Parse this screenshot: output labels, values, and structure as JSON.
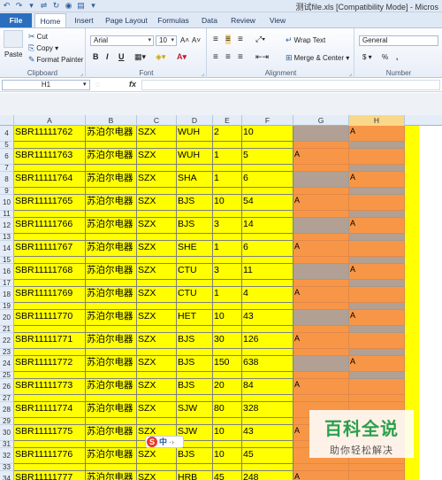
{
  "window": {
    "title": "测试file.xls  [Compatibility Mode] - Micros"
  },
  "qat": [
    "↶",
    "↷",
    "▾",
    "⇌",
    "↻",
    "◉",
    "▤",
    "▾"
  ],
  "tabs": [
    "File",
    "Home",
    "Insert",
    "Page Layout",
    "Formulas",
    "Data",
    "Review",
    "View"
  ],
  "ribbon": {
    "clipboard": {
      "paste": "Paste",
      "cut": "Cut",
      "copy": "Copy ▾",
      "format_painter": "Format Painter",
      "label": "Clipboard"
    },
    "font": {
      "name": "Arial",
      "size": "10",
      "grow": "A˄",
      "shrink": "A˅",
      "bold": "B",
      "italic": "I",
      "underline": "U",
      "label": "Font"
    },
    "alignment": {
      "wrap": "Wrap Text",
      "merge": "Merge & Center ▾",
      "label": "Alignment"
    },
    "number": {
      "format": "General",
      "currency": "$ ▾",
      "percent": "%",
      "comma": ",",
      "label": "Number"
    }
  },
  "formula_bar": {
    "name_box": "H1",
    "fx": "fx"
  },
  "columns": [
    "A",
    "B",
    "C",
    "D",
    "E",
    "F",
    "G",
    "H"
  ],
  "colors": {
    "data_fill": "#ffff00",
    "accent_fill": "#f79646",
    "marked_fill": "#b1a093"
  },
  "rows": [
    {
      "n": "4",
      "a": "SBR11111762",
      "b": "苏泊尔电器",
      "c": "SZX",
      "d": "WUH",
      "e": "2",
      "f": "10",
      "g": "",
      "h": "A",
      "g_dark": true,
      "h_dark": false
    },
    {
      "n": "5",
      "a": "",
      "b": "",
      "c": "",
      "d": "",
      "e": "",
      "f": "",
      "g": "",
      "h": "",
      "g_dark": false,
      "h_dark": true
    },
    {
      "n": "6",
      "a": "SBR11111763",
      "b": "苏泊尔电器",
      "c": "SZX",
      "d": "WUH",
      "e": "1",
      "f": "5",
      "g": "A",
      "h": "",
      "g_dark": false,
      "h_dark": false
    },
    {
      "n": "7",
      "a": "",
      "b": "",
      "c": "",
      "d": "",
      "e": "",
      "f": "",
      "g": "",
      "h": "",
      "g_dark": false,
      "h_dark": true
    },
    {
      "n": "8",
      "a": "SBR11111764",
      "b": "苏泊尔电器",
      "c": "SZX",
      "d": "SHA",
      "e": "1",
      "f": "6",
      "g": "",
      "h": "A",
      "g_dark": true,
      "h_dark": false
    },
    {
      "n": "9",
      "a": "",
      "b": "",
      "c": "",
      "d": "",
      "e": "",
      "f": "",
      "g": "",
      "h": "",
      "g_dark": false,
      "h_dark": true
    },
    {
      "n": "10",
      "a": "SBR11111765",
      "b": "苏泊尔电器",
      "c": "SZX",
      "d": "BJS",
      "e": "10",
      "f": "54",
      "g": "A",
      "h": "",
      "g_dark": false,
      "h_dark": false
    },
    {
      "n": "11",
      "a": "",
      "b": "",
      "c": "",
      "d": "",
      "e": "",
      "f": "",
      "g": "",
      "h": "",
      "g_dark": false,
      "h_dark": true
    },
    {
      "n": "12",
      "a": "SBR11111766",
      "b": "苏泊尔电器",
      "c": "SZX",
      "d": "BJS",
      "e": "3",
      "f": "14",
      "g": "",
      "h": "A",
      "g_dark": true,
      "h_dark": false
    },
    {
      "n": "13",
      "a": "",
      "b": "",
      "c": "",
      "d": "",
      "e": "",
      "f": "",
      "g": "",
      "h": "",
      "g_dark": false,
      "h_dark": true
    },
    {
      "n": "14",
      "a": "SBR11111767",
      "b": "苏泊尔电器",
      "c": "SZX",
      "d": "SHE",
      "e": "1",
      "f": "6",
      "g": "A",
      "h": "",
      "g_dark": false,
      "h_dark": false
    },
    {
      "n": "15",
      "a": "",
      "b": "",
      "c": "",
      "d": "",
      "e": "",
      "f": "",
      "g": "",
      "h": "",
      "g_dark": false,
      "h_dark": true
    },
    {
      "n": "16",
      "a": "SBR11111768",
      "b": "苏泊尔电器",
      "c": "SZX",
      "d": "CTU",
      "e": "3",
      "f": "11",
      "g": "",
      "h": "A",
      "g_dark": true,
      "h_dark": false
    },
    {
      "n": "17",
      "a": "",
      "b": "",
      "c": "",
      "d": "",
      "e": "",
      "f": "",
      "g": "",
      "h": "",
      "g_dark": false,
      "h_dark": true
    },
    {
      "n": "18",
      "a": "SBR11111769",
      "b": "苏泊尔电器",
      "c": "SZX",
      "d": "CTU",
      "e": "1",
      "f": "4",
      "g": "A",
      "h": "",
      "g_dark": false,
      "h_dark": false
    },
    {
      "n": "19",
      "a": "",
      "b": "",
      "c": "",
      "d": "",
      "e": "",
      "f": "",
      "g": "",
      "h": "",
      "g_dark": false,
      "h_dark": true
    },
    {
      "n": "20",
      "a": "SBR11111770",
      "b": "苏泊尔电器",
      "c": "SZX",
      "d": "HET",
      "e": "10",
      "f": "43",
      "g": "",
      "h": "A",
      "g_dark": true,
      "h_dark": false
    },
    {
      "n": "21",
      "a": "",
      "b": "",
      "c": "",
      "d": "",
      "e": "",
      "f": "",
      "g": "",
      "h": "",
      "g_dark": false,
      "h_dark": true
    },
    {
      "n": "22",
      "a": "SBR11111771",
      "b": "苏泊尔电器",
      "c": "SZX",
      "d": "BJS",
      "e": "30",
      "f": "126",
      "g": "A",
      "h": "",
      "g_dark": false,
      "h_dark": false
    },
    {
      "n": "23",
      "a": "",
      "b": "",
      "c": "",
      "d": "",
      "e": "",
      "f": "",
      "g": "",
      "h": "",
      "g_dark": false,
      "h_dark": true
    },
    {
      "n": "24",
      "a": "SBR11111772",
      "b": "苏泊尔电器",
      "c": "SZX",
      "d": "BJS",
      "e": "150",
      "f": "638",
      "g": "",
      "h": "A",
      "g_dark": true,
      "h_dark": false
    },
    {
      "n": "25",
      "a": "",
      "b": "",
      "c": "",
      "d": "",
      "e": "",
      "f": "",
      "g": "",
      "h": "",
      "g_dark": false,
      "h_dark": true
    },
    {
      "n": "26",
      "a": "SBR11111773",
      "b": "苏泊尔电器",
      "c": "SZX",
      "d": "BJS",
      "e": "20",
      "f": "84",
      "g": "A",
      "h": "",
      "g_dark": false,
      "h_dark": false
    },
    {
      "n": "27",
      "a": "",
      "b": "",
      "c": "",
      "d": "",
      "e": "",
      "f": "",
      "g": "",
      "h": "",
      "g_dark": false,
      "h_dark": false
    },
    {
      "n": "28",
      "a": "SBR11111774",
      "b": "苏泊尔电器",
      "c": "SZX",
      "d": "SJW",
      "e": "80",
      "f": "328",
      "g": "",
      "h": "",
      "g_dark": false,
      "h_dark": false
    },
    {
      "n": "29",
      "a": "",
      "b": "",
      "c": "",
      "d": "",
      "e": "",
      "f": "",
      "g": "",
      "h": "",
      "g_dark": false,
      "h_dark": false
    },
    {
      "n": "30",
      "a": "SBR11111775",
      "b": "苏泊尔电器",
      "c": "SZX",
      "d": "SJW",
      "e": "10",
      "f": "43",
      "g": "A",
      "h": "",
      "g_dark": false,
      "h_dark": false
    },
    {
      "n": "31",
      "a": "",
      "b": "",
      "c": "",
      "d": "",
      "e": "",
      "f": "",
      "g": "",
      "h": "",
      "g_dark": false,
      "h_dark": false
    },
    {
      "n": "32",
      "a": "SBR11111776",
      "b": "苏泊尔电器",
      "c": "SZX",
      "d": "BJS",
      "e": "10",
      "f": "45",
      "g": "",
      "h": "",
      "g_dark": false,
      "h_dark": false
    },
    {
      "n": "33",
      "a": "",
      "b": "",
      "c": "",
      "d": "",
      "e": "",
      "f": "",
      "g": "",
      "h": "",
      "g_dark": false,
      "h_dark": false
    },
    {
      "n": "34",
      "a": "SBR11111777",
      "b": "苏泊尔电器",
      "c": "SZX",
      "d": "HRB",
      "e": "45",
      "f": "248",
      "g": "A",
      "h": "",
      "g_dark": false,
      "h_dark": false
    }
  ],
  "watermark": {
    "title": "百科全说",
    "subtitle": "助你轻松解决"
  },
  "ime": {
    "logo": "S",
    "lang": "中",
    "extra": "·›"
  }
}
